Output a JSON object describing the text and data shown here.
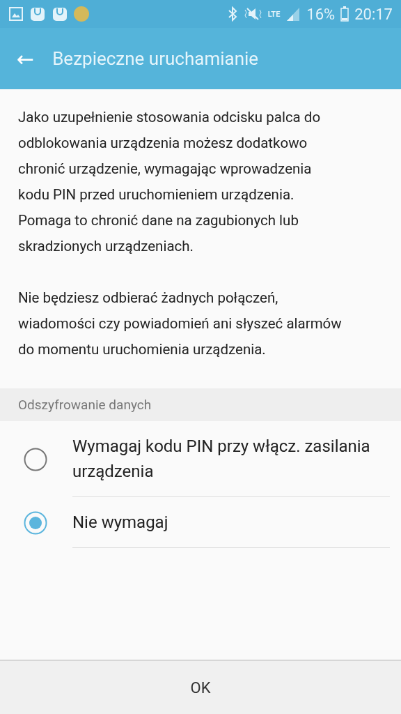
{
  "status_bar": {
    "network": "LTE",
    "battery": "16%",
    "time": "20:17"
  },
  "app_bar": {
    "back": "←",
    "title": "Bezpieczne uruchamianie"
  },
  "paragraphs": [
    "Jako uzupełnienie stosowania odcisku palca do odblokowania urządzenia możesz dodatkowo chronić urządzenie, wymagając wprowadzenia kodu PIN przed uruchomieniem urządzenia. Pomaga to chronić dane na zagubionych lub skradzionych urządzeniach.",
    "Nie będziesz odbierać żadnych połączeń, wiadomości czy powiadomień ani słyszeć alarmów do momentu uruchomienia urządzenia."
  ],
  "section": {
    "title": "Odszyfrowanie danych"
  },
  "options": [
    {
      "label": "Wymagaj kodu PIN przy włącz. zasilania urządzenia",
      "selected": false
    },
    {
      "label": "Nie wymagaj",
      "selected": true
    }
  ],
  "button": "OK"
}
